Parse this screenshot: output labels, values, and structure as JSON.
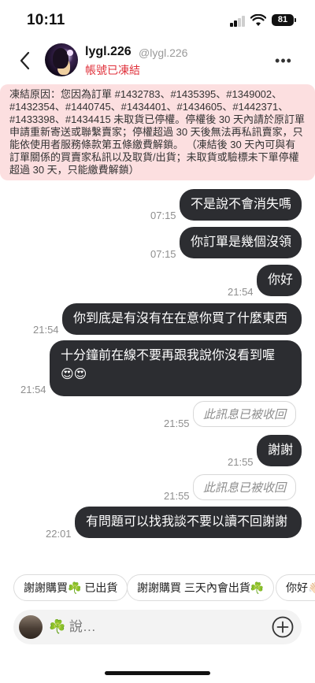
{
  "status_bar": {
    "time": "10:11",
    "battery": "81"
  },
  "header": {
    "username": "lygl.226",
    "handle": "@lygl.226",
    "account_status": "帳號已凍結"
  },
  "notice": {
    "text": "凍結原因：您因為訂單 #1432783、#1435395、#1349002、#1432354、#1440745、#1434401、#1434605、#1442371、#1433398、#1434415 未取貨已停權。停權後 30 天內請於原訂單申請重新寄送或聯繫賣家；停權超過 30 天後無法再私訊賣家，只能依使用者服務條款第五條繳費解鎖。\n（凍結後 30 天內可與有訂單關係的買賣家私訊以及取貨/出貨；未取貨或驗標未下單停權超過 30 天，只能繳費解鎖）"
  },
  "messages": [
    {
      "text": "不是說不會消失嗎",
      "time": "07:15"
    },
    {
      "text": "你訂單是幾個沒領",
      "time": "07:15"
    },
    {
      "text": "你好",
      "time": "21:54"
    },
    {
      "text": "你到底是有沒有在在意你買了什麼東西",
      "time": "21:54"
    },
    {
      "text": "十分鐘前在線不要再跟我說你沒看到喔",
      "emoji": "😍😍",
      "time": "21:54"
    },
    {
      "recalled": "此訊息已被收回",
      "time": "21:55"
    },
    {
      "text": "謝謝",
      "time": "21:55"
    },
    {
      "recalled": "此訊息已被收回",
      "time": "21:55"
    },
    {
      "text": "有問題可以找我談不要以讀不回謝謝",
      "time": "22:01"
    }
  ],
  "quick_replies": [
    "謝謝購買☘️ 已出貨",
    "謝謝購買 三天內會出貨☘️",
    "你好👋🏻"
  ],
  "composer": {
    "placeholder": "☘️ 說…"
  },
  "colors": {
    "bubble": "#2c2d31",
    "notice_bg": "#fcdfe0",
    "status_red": "#e0323c",
    "timestamp": "#8e8e8e"
  },
  "icons": {
    "back": "back-arrow-icon",
    "more": "more-dots-icon",
    "add": "add-circle-icon"
  }
}
